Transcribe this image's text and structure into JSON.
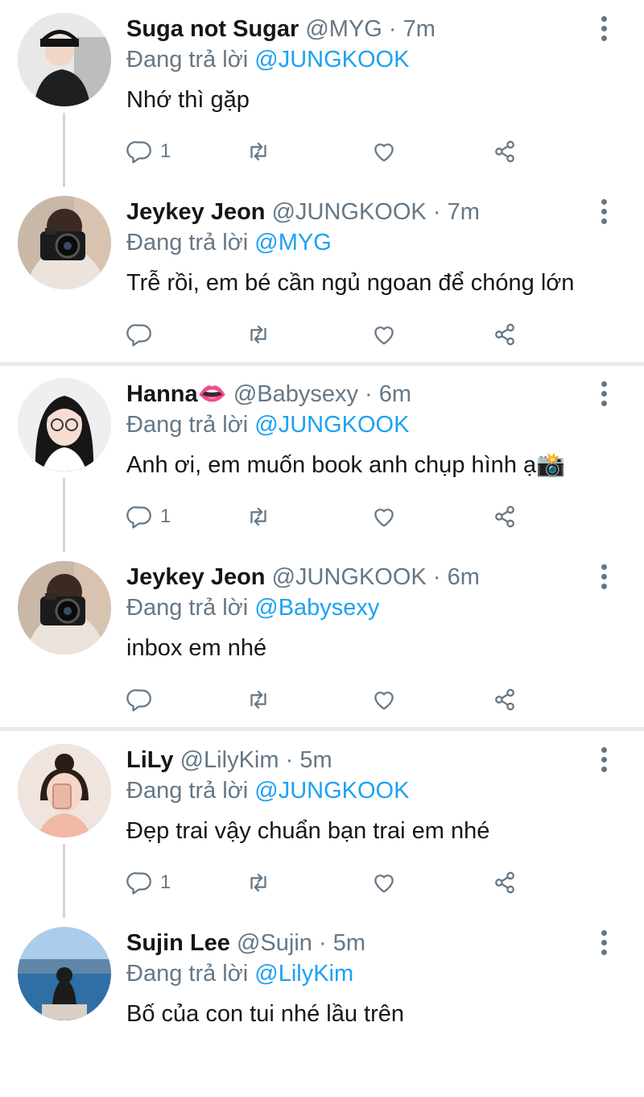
{
  "tweets": [
    {
      "name": "Suga not Sugar",
      "handle": "@MYG",
      "dot": "·",
      "time": "7m",
      "reply_prefix": "Đang trả lời",
      "reply_to": "@JUNGKOOK",
      "text": "Nhớ thì gặp",
      "reply_count": "1",
      "avatar": "avatar-dark-hat"
    },
    {
      "name": "Jeykey Jeon",
      "handle": "@JUNGKOOK",
      "dot": "·",
      "time": "7m",
      "reply_prefix": "Đang trả lời",
      "reply_to": "@MYG",
      "text": "Trễ rồi, em bé cần ngủ ngoan để chóng lớn",
      "reply_count": "",
      "avatar": "avatar-camera"
    },
    {
      "name": "Hanna👄",
      "handle": "@Babysexy",
      "dot": "·",
      "time": "6m",
      "reply_prefix": "Đang trả lời",
      "reply_to": "@JUNGKOOK",
      "text": "Anh ơi, em muốn book anh chụp hình ạ📸",
      "reply_count": "1",
      "avatar": "avatar-girl-glasses"
    },
    {
      "name": "Jeykey Jeon",
      "handle": "@JUNGKOOK",
      "dot": "·",
      "time": "6m",
      "reply_prefix": "Đang trả lời",
      "reply_to": "@Babysexy",
      "text": "inbox em nhé",
      "reply_count": "",
      "avatar": "avatar-camera"
    },
    {
      "name": "LiLy",
      "handle": "@LilyKim",
      "dot": "·",
      "time": "5m",
      "reply_prefix": "Đang trả lời",
      "reply_to": "@JUNGKOOK",
      "text": "Đẹp trai vậy chuẩn bạn trai em nhé",
      "reply_count": "1",
      "avatar": "avatar-girl-bun"
    },
    {
      "name": "Sujin Lee",
      "handle": "@Sujin",
      "dot": "·",
      "time": "5m",
      "reply_prefix": "Đang trả lời",
      "reply_to": "@LilyKim",
      "text": "Bố của con tui nhé lầu trên",
      "reply_count": "",
      "avatar": "avatar-lake"
    }
  ],
  "icons": {
    "reply": "reply-icon",
    "retweet": "retweet-icon",
    "like": "heart-icon",
    "share": "share-icon",
    "more": "more-vertical-icon"
  },
  "colors": {
    "link": "#1da1f2",
    "secondary": "#657786",
    "divider": "#e6ecf0",
    "thread": "#ccd6dd"
  }
}
